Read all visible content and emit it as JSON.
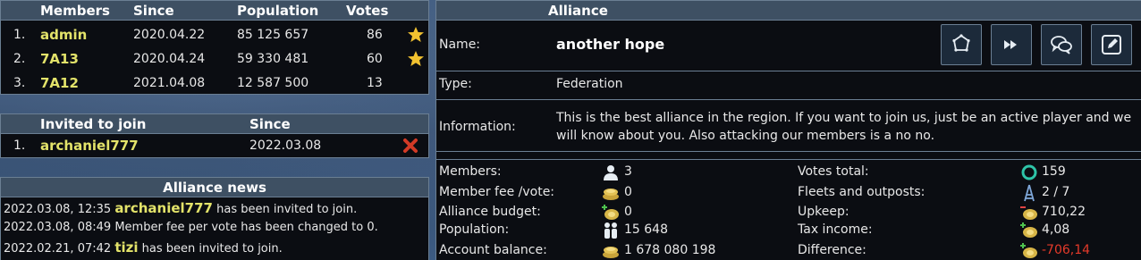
{
  "members": {
    "headers": {
      "members": "Members",
      "since": "Since",
      "population": "Population",
      "votes": "Votes"
    },
    "rows": [
      {
        "rank": "1.",
        "name": "admin",
        "since": "2020.04.22",
        "population": "85 125 657",
        "votes": "86",
        "starred": true
      },
      {
        "rank": "2.",
        "name": "7A13",
        "since": "2020.04.24",
        "population": "59 330 481",
        "votes": "60",
        "starred": true
      },
      {
        "rank": "3.",
        "name": "7A12",
        "since": "2021.04.08",
        "population": "12 587 500",
        "votes": "13",
        "starred": false
      }
    ]
  },
  "invited": {
    "headers": {
      "invited": "Invited to join",
      "since": "Since"
    },
    "rows": [
      {
        "rank": "1.",
        "name": "archaniel777",
        "since": "2022.03.08"
      }
    ]
  },
  "news": {
    "title": "Alliance news",
    "items": [
      {
        "time": "2022.03.08, 12:35",
        "actor": "archaniel777",
        "text": "has been invited to join."
      },
      {
        "time": "2022.03.08, 08:49",
        "actor": "",
        "text": "Member fee per vote has been changed to 0."
      },
      {
        "time": "2022.02.21, 07:42",
        "actor": "tizi",
        "text": "has been invited to join."
      }
    ]
  },
  "alliance": {
    "title": "Alliance",
    "name_label": "Name:",
    "name": "another hope",
    "type_label": "Type:",
    "type": "Federation",
    "info_label": "Information:",
    "info": "This is the best alliance in the region. If you want to join us, just be an active player and we will know about you. Also attacking our members is a no no.",
    "tool_icons": [
      "star-outline-icon",
      "fast-forward-icon",
      "chat-bubbles-icon",
      "edit-icon"
    ],
    "stats_left": [
      {
        "label": "Members:",
        "value": "3",
        "icon": "person-icon"
      },
      {
        "label": "Member fee /vote:",
        "value": "0",
        "icon": "coins-icon"
      },
      {
        "label": "Alliance budget:",
        "value": "0",
        "icon": "coin-plus-icon"
      },
      {
        "label": "Population:",
        "value": "15 648",
        "icon": "people-icon"
      },
      {
        "label": "Account balance:",
        "value": "1 678 080 198",
        "icon": "coins-icon"
      }
    ],
    "stats_right": [
      {
        "label": "Votes total:",
        "value": "159",
        "icon": "ring-icon"
      },
      {
        "label": "Fleets and outposts:",
        "value": "2 / 7",
        "icon": "tower-icon"
      },
      {
        "label": "Upkeep:",
        "value": "710,22",
        "icon": "coin-minus-icon"
      },
      {
        "label": "Tax income:",
        "value": "4,08",
        "icon": "coin-plus-icon"
      },
      {
        "label": "Difference:",
        "value": "-706,14",
        "icon": "coin-plus-icon"
      }
    ]
  },
  "colors": {
    "accent_gold": "#e3e36a",
    "header_bg": "#3e5063",
    "negative": "#e53a2a",
    "star": "#f2c230"
  }
}
